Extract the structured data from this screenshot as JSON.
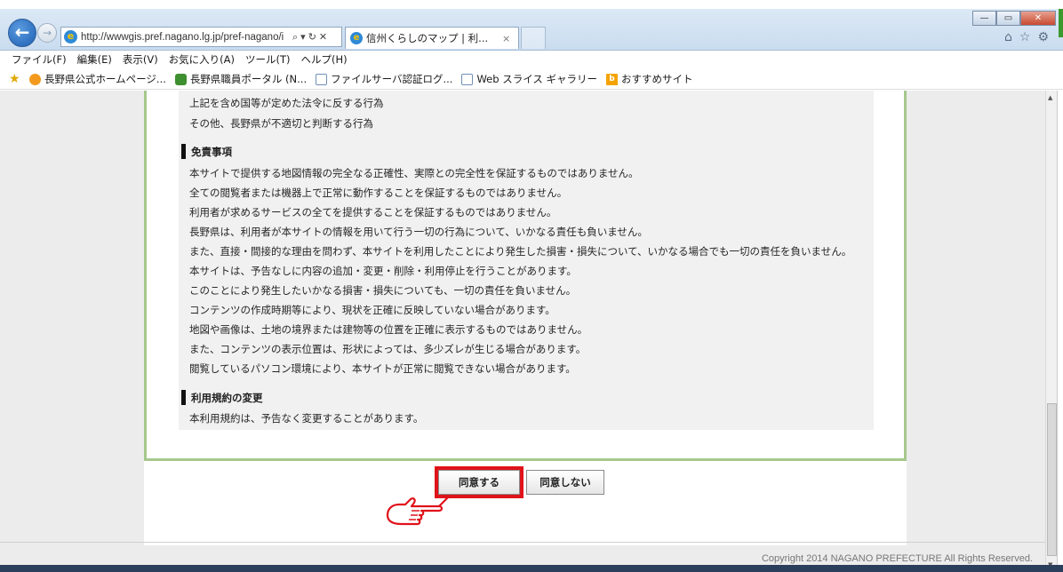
{
  "browser": {
    "address_url": "http://wwwgis.pref.nagano.lg.jp/pref-nagano/i",
    "address_tools": [
      "⌕",
      "▾",
      "↻",
      "✕"
    ],
    "tab_title": "信州くらしのマップ | 利...",
    "tab_close": "×",
    "window_controls": [
      "—",
      "▭",
      "✕"
    ],
    "right_icons": [
      "home-icon",
      "star-icon",
      "gear-icon"
    ]
  },
  "menu": [
    "ファイル(F)",
    "編集(E)",
    "表示(V)",
    "お気に入り(A)",
    "ツール(T)",
    "ヘルプ(H)"
  ],
  "favorites": [
    {
      "icon": "orange-circle",
      "label": "長野県公式ホームページ..."
    },
    {
      "icon": "green-figure",
      "label": "長野県職員ポータル (N..."
    },
    {
      "icon": "page",
      "label": "ファイルサーバ認証ログ..."
    },
    {
      "icon": "page",
      "label": "Web スライス ギャラリー"
    },
    {
      "icon": "bing",
      "label": "おすすめサイト"
    }
  ],
  "terms": {
    "prohibited_lines": [
      "上記を含め国等が定めた法令に反する行為",
      "その他、長野県が不適切と判断する行為"
    ],
    "disclaimer_heading": "免責事項",
    "disclaimer_lines": [
      "本サイトで提供する地図情報の完全なる正確性、実際との完全性を保証するものではありません。",
      "全ての閲覧者または機器上で正常に動作することを保証するものではありません。",
      "利用者が求めるサービスの全てを提供することを保証するものではありません。",
      "長野県は、利用者が本サイトの情報を用いて行う一切の行為について、いかなる責任も負いません。",
      "また、直接・間接的な理由を問わず、本サイトを利用したことにより発生した損害・損失について、いかなる場合でも一切の責任を負いません。",
      "本サイトは、予告なしに内容の追加・変更・削除・利用停止を行うことがあります。",
      "このことにより発生したいかなる損害・損失についても、一切の責任を負いません。",
      "コンテンツの作成時期等により、現状を正確に反映していない場合があります。",
      "地図や画像は、土地の境界または建物等の位置を正確に表示するものではありません。",
      "また、コンテンツの表示位置は、形状によっては、多少ズレが生じる場合があります。",
      "閲覧しているパソコン環境により、本サイトが正常に閲覧できない場合があります。"
    ],
    "change_heading": "利用規約の変更",
    "change_lines": [
      "本利用規約は、予告なく変更することがあります。"
    ]
  },
  "buttons": {
    "agree": "同意する",
    "disagree": "同意しない"
  },
  "footer": {
    "copyright": "Copyright 2014 NAGANO PREFECTURE All Rights Reserved."
  },
  "colors": {
    "highlight": "#e0121a",
    "frame_green": "#a6c88c"
  }
}
